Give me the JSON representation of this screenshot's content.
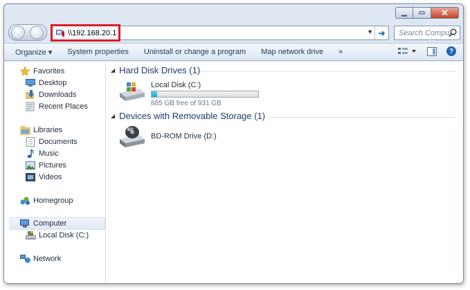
{
  "address_bar": {
    "path": "\\\\192.168.20.1"
  },
  "search": {
    "placeholder": "Search Compu..."
  },
  "toolbar": {
    "organize": "Organize ▾",
    "system_properties": "System properties",
    "uninstall": "Uninstall or change a program",
    "map_drive": "Map network drive",
    "more": "»"
  },
  "sidebar": {
    "favorites": "Favorites",
    "desktop": "Desktop",
    "downloads": "Downloads",
    "recent_places": "Recent Places",
    "libraries": "Libraries",
    "documents": "Documents",
    "music": "Music",
    "pictures": "Pictures",
    "videos": "Videos",
    "homegroup": "Homegroup",
    "computer": "Computer",
    "local_disk": "Local Disk (C:)",
    "network": "Network"
  },
  "main": {
    "hdd_header": "Hard Disk Drives (1)",
    "local_disk_name": "Local Disk (C:)",
    "local_disk_free": "885 GB free of 931 GB",
    "local_disk_used_fraction": 0.05,
    "removable_header": "Devices with Removable Storage (1)",
    "bd_rom_name": "BD-ROM Drive (D:)"
  },
  "colors": {
    "highlight_border": "#d61e2a",
    "accent": "#1e3a6e",
    "progress": "#26b0d0"
  }
}
